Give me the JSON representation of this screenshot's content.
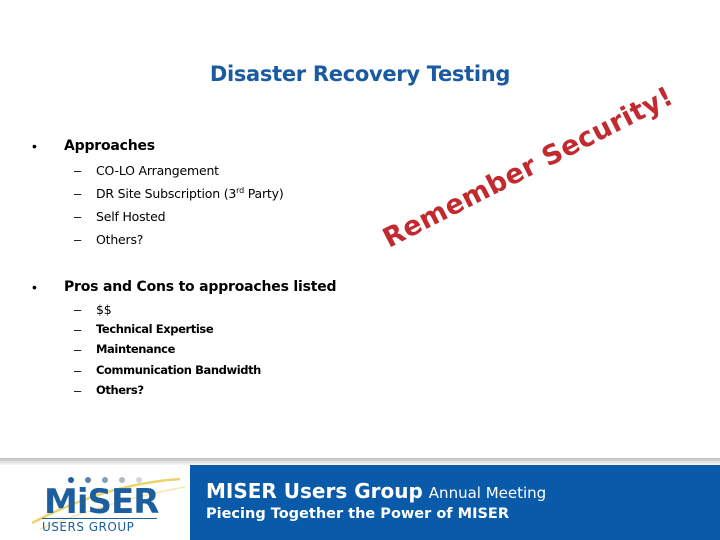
{
  "slide": {
    "title": "Disaster Recovery Testing",
    "bullets": [
      {
        "marker": "•",
        "text": "Approaches",
        "sub_marker": "–",
        "subitems": [
          {
            "text": "CO-LO Arrangement"
          },
          {
            "text_before": "DR Site Subscription (3",
            "superscript": "rd",
            "text_after": " Party)"
          },
          {
            "text": "Self Hosted"
          },
          {
            "text": "Others?"
          }
        ]
      },
      {
        "marker": "•",
        "text": "Pros and Cons to approaches listed",
        "sub_marker": "–",
        "subitems": [
          {
            "text": "$$"
          },
          {
            "text": "Technical Expertise"
          },
          {
            "text": "Maintenance"
          },
          {
            "text": "Communication Bandwidth"
          },
          {
            "text": "Others?"
          }
        ]
      }
    ],
    "watermark": "Remember Security!"
  },
  "footer": {
    "logo": {
      "wordmark": "MiSER",
      "subtitle": "USERS GROUP",
      "dot_colors": [
        "#1d5f9e",
        "#5a7fa6",
        "#8a9bb0",
        "#aeb8c4",
        "#cfd6de"
      ],
      "swoosh_color": "#e8c84a"
    },
    "headline": "MISER Users Group",
    "headline_suffix": "Annual Meeting",
    "tagline": "Piecing Together the Power of MISER",
    "band_color": "#0a5aaa"
  }
}
